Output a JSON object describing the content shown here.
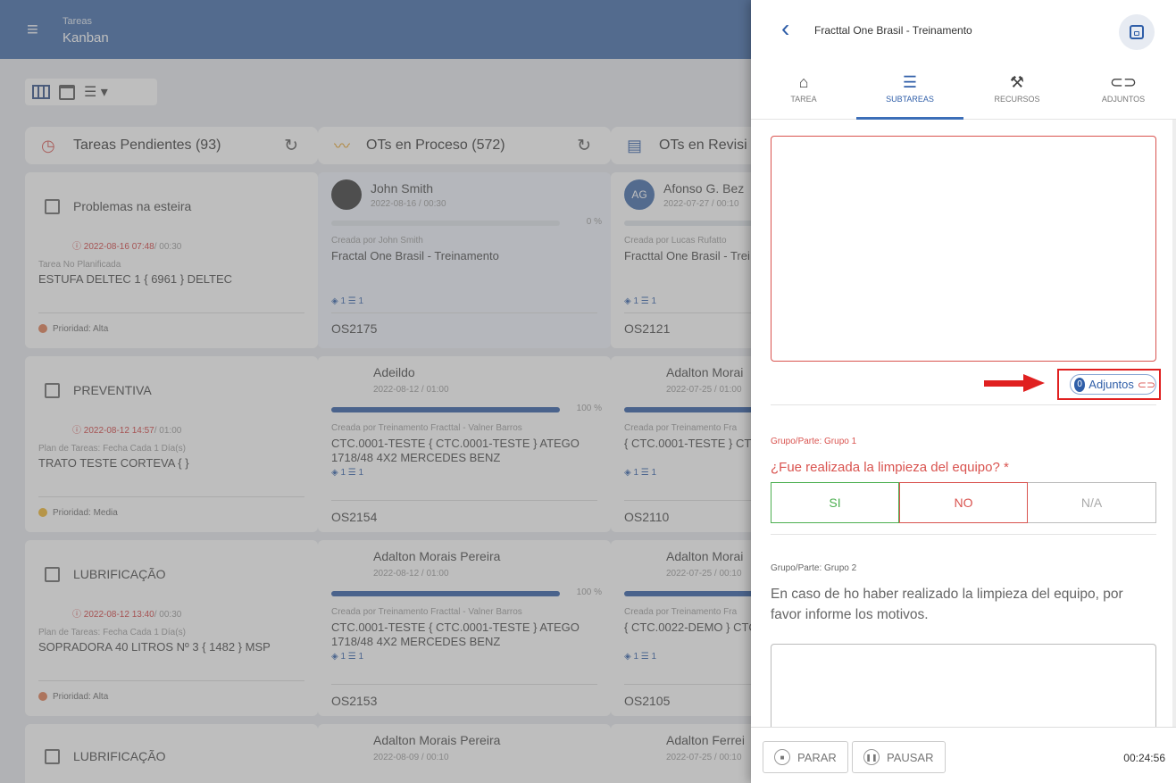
{
  "topbar": {
    "section": "Tareas",
    "view": "Kanban"
  },
  "columns": [
    {
      "title": "Tareas Pendientes (93)"
    },
    {
      "title": "OTs en Proceso (572)"
    },
    {
      "title": "OTs en Revisi"
    }
  ],
  "pending": [
    {
      "title": "Problemas na esteira",
      "date": "2022-08-16 07:48",
      "dur": "/ 00:30",
      "type": "Tarea No Planificada",
      "asset": "ESTUFA DELTEC 1 { 6961 } DELTEC",
      "priority": "Prioridad: Alta"
    },
    {
      "title": "PREVENTIVA",
      "date": "2022-08-12 14:57",
      "dur": "/ 01:00",
      "type": "Plan de Tareas: Fecha Cada 1 Día(s)",
      "asset": "TRATO TESTE CORTEVA { }",
      "priority": "Prioridad: Media"
    },
    {
      "title": "LUBRIFICAÇÃO",
      "date": "2022-08-12 13:40",
      "dur": "/ 00:30",
      "type": "Plan de Tareas: Fecha Cada 1 Día(s)",
      "asset": "SOPRADORA 40 LITROS Nº 3 { 1482 } MSP",
      "priority": "Prioridad: Alta"
    },
    {
      "title": "LUBRIFICAÇÃO"
    }
  ],
  "process": [
    {
      "name": "John Smith",
      "date": "2022-08-16 / 00:30",
      "percent": "0 %",
      "progress": 0,
      "creator": "Creada por John Smith",
      "desc": "Fractal One Brasil - Treinamento",
      "counts": "1 ☰ 1",
      "code": "OS2175"
    },
    {
      "name": "Adeildo",
      "date": "2022-08-12 / 01:00",
      "percent": "100 %",
      "progress": 100,
      "creator": "Creada por Treinamento Fracttal - Valner Barros",
      "desc": "CTC.0001-TESTE { CTC.0001-TESTE } ATEGO",
      "desc2": "1718/48 4X2 MERCEDES BENZ",
      "counts": "1 ☰ 1",
      "code": "OS2154"
    },
    {
      "name": "Adalton Morais Pereira",
      "date": "2022-08-12 / 01:00",
      "percent": "100 %",
      "progress": 100,
      "creator": "Creada por Treinamento Fracttal - Valner Barros",
      "desc": "CTC.0001-TESTE { CTC.0001-TESTE } ATEGO",
      "desc2": "1718/48 4X2 MERCEDES BENZ",
      "counts": "1 ☰ 1",
      "code": "OS2153"
    },
    {
      "name": "Adalton Morais Pereira",
      "date": "2022-08-09 / 00:10"
    }
  ],
  "review": [
    {
      "name": "Afonso G. Bez",
      "initials": "AG",
      "date": "2022-07-27 / 00:10",
      "creator": "Creada por Lucas Rufatto",
      "desc": "Fracttal One Brasil - Trei",
      "counts": "1 ☰ 1",
      "code": "OS2121"
    },
    {
      "name": "Adalton Morai",
      "date": "2022-07-25 / 01:00",
      "creator": "Creada por Treinamento Fra",
      "desc": "{ CTC.0001-TESTE } CTC",
      "counts": "1 ☰ 1",
      "code": "OS2110"
    },
    {
      "name": "Adalton Morai",
      "date": "2022-07-25 / 00:10",
      "creator": "Creada por Treinamento Fra",
      "desc": "{ CTC.0022-DEMO } CTC",
      "counts": "1 ☰ 1",
      "code": "OS2105"
    },
    {
      "name": "Adalton Ferrei",
      "date": "2022-07-25 / 00:10"
    }
  ],
  "panel": {
    "title": "Fracttal One Brasil - Treinamento",
    "tabs": [
      "TAREA",
      "SUBTAREAS",
      "RECURSOS",
      "ADJUNTOS"
    ],
    "adjuntos_count": "0",
    "adjuntos_label": "Adjuntos",
    "group1": "Grupo/Parte: Grupo 1",
    "question1": "¿Fue realizada la limpieza del equipo? *",
    "options": [
      "SI",
      "NO",
      "N/A"
    ],
    "group2": "Grupo/Parte: Grupo 2",
    "question2_line1": "En caso de ho haber realizado la limpieza del equipo, por",
    "question2_line2": "favor informe los motivos.",
    "stop": "PARAR",
    "pause": "PAUSAR",
    "timer": "00:24:56"
  },
  "colors": {
    "topbar": "#3d69a8",
    "accent": "#2f5ea8",
    "danger": "#d9534f",
    "success": "#4caf50",
    "highlight": "#e02020"
  }
}
